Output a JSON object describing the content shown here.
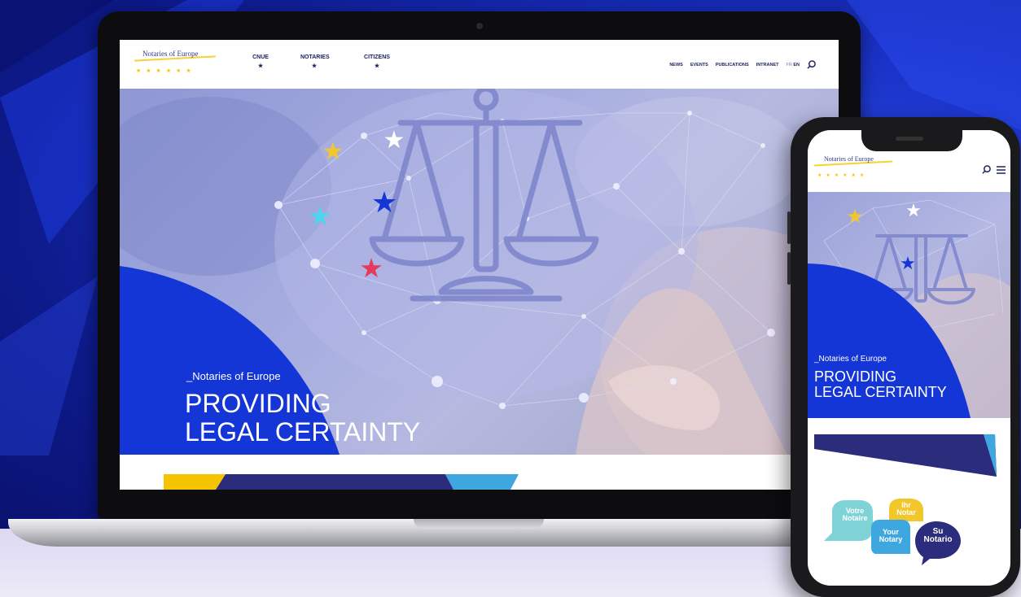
{
  "site": {
    "logo_text": "Notaries of Europe",
    "nav_main": [
      {
        "label": "CNUE"
      },
      {
        "label": "NOTARIES"
      },
      {
        "label": "CITIZENS"
      }
    ],
    "nav_right": [
      "NEWS",
      "EVENTS",
      "PUBLICATIONS",
      "INTRANET"
    ],
    "lang_fr": "FR",
    "lang_en": "EN"
  },
  "hero": {
    "eyebrow": "_Notaries of Europe",
    "title_line1": "PROVIDING",
    "title_line2": "LEGAL CERTAINTY"
  },
  "mobile": {
    "logo_text": "Notaries of Europe",
    "eyebrow": "_Notaries of Europe",
    "title_line1": "PROVIDING",
    "title_line2": "LEGAL CERTAINTY",
    "bubbles": {
      "fr_line1": "Votre",
      "fr_line2": "Notaire",
      "de_line1": "Ihr",
      "de_line2": "Notar",
      "en_line1": "Your",
      "en_line2": "Notary",
      "es_line1": "Su",
      "es_line2": "Notario"
    }
  },
  "colors": {
    "brand_blue": "#1436d6",
    "navy": "#1b2460",
    "gold": "#f5c400",
    "sky": "#3fa7e0"
  }
}
